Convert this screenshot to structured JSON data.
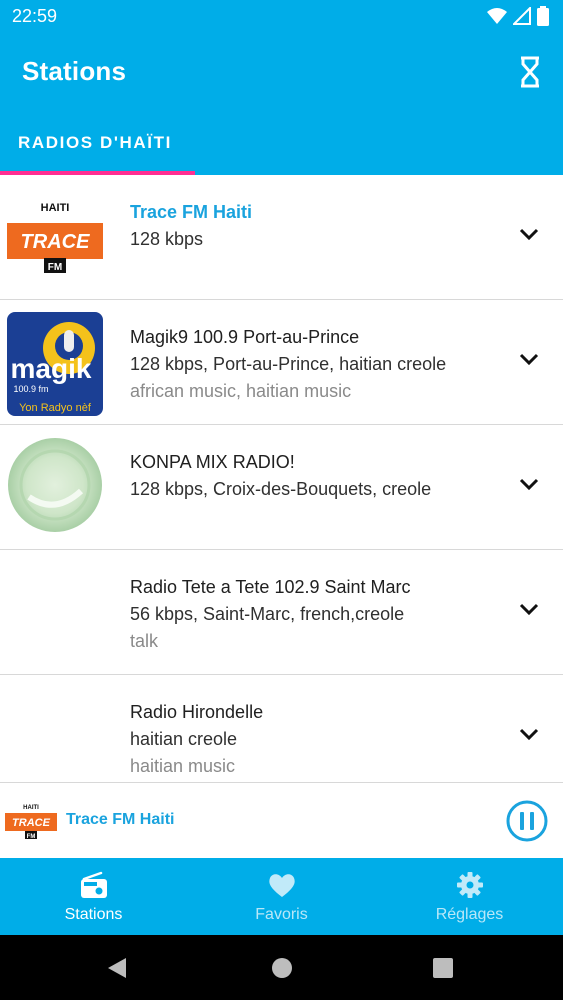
{
  "status_bar": {
    "time": "22:59"
  },
  "toolbar": {
    "title": "Stations"
  },
  "tabs": [
    {
      "label": "RADIOS D'HAÏTI",
      "selected": true
    }
  ],
  "stations": [
    {
      "title": "Trace FM Haiti",
      "details": "128 kbps",
      "tags": "",
      "active": true,
      "logo": {
        "top_text": "HAITI",
        "brand": "TRACE",
        "badge": "FM"
      }
    },
    {
      "title": "Magik9 100.9  Port-au-Prince",
      "details": "128 kbps, Port-au-Prince, haitian creole",
      "tags": "african music, haitian music",
      "logo": {
        "brand": "magik",
        "freq": "100.9 fm",
        "slogan": "Yon Radyo nèf"
      }
    },
    {
      "title": "KONPA MIX RADIO!",
      "details": "128 kbps, Croix-des-Bouquets, creole",
      "tags": ""
    },
    {
      "title": "Radio Tete a Tete 102.9 Saint Marc",
      "details": "56 kbps, Saint-Marc, french,creole",
      "tags": "talk"
    },
    {
      "title": "Radio Hirondelle",
      "details": "haitian creole",
      "tags": "haitian music"
    }
  ],
  "now_playing": {
    "title": "Trace FM Haiti",
    "logo": {
      "top_text": "HAITI",
      "brand": "TRACE",
      "badge": "FM"
    }
  },
  "bottom_nav": [
    {
      "label": "Stations",
      "icon": "radio-icon",
      "selected": true
    },
    {
      "label": "Favoris",
      "icon": "heart-icon"
    },
    {
      "label": "Réglages",
      "icon": "gear-icon"
    }
  ],
  "colors": {
    "primary": "#00ADE8",
    "accent": "#1aa3de",
    "indicator": "#ff2f92",
    "trace_orange": "#ee6a1f",
    "magik_blue": "#1b3f94",
    "magik_yellow": "#f4c21b"
  }
}
